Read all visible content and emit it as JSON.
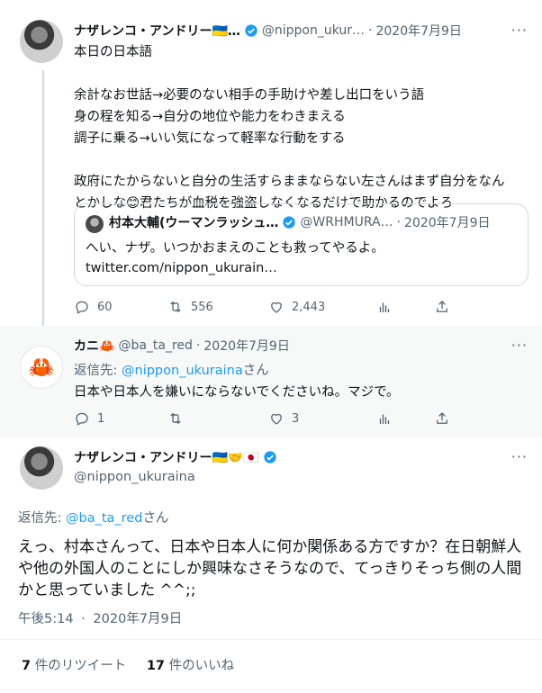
{
  "tweet1": {
    "name": "ナザレンコ・アンドリー🇺🇦…",
    "handle": "@nippon_ukur…",
    "separator": "·",
    "date": "2020年7月9日",
    "more": "···",
    "lines": [
      "本日の日本語",
      "",
      "余計なお世話→必要のない相手の手助けや差し出口をいう語",
      "身の程を知る→自分の地位や能力をわきまえる",
      "調子に乗る→いい気になって軽率な行動をする",
      "",
      "政府にたからないと自分の生活すらままならない左さんはまず自分をなん",
      "とかしな😊君たちが血税を強盗しなくなるだけで助かるのでよろ"
    ],
    "quote": {
      "name": "村本大輔(ウーマンラッシュ…",
      "handle": "@WRHMURA…",
      "separator": "·",
      "date": "2020年7月9日",
      "line1": "へい、ナザ。いつかおまえのことも救ってやるよ。",
      "line2": "twitter.com/nippon_ukurain…"
    },
    "actions": {
      "replies": "60",
      "retweets": "556",
      "likes": "2,443"
    }
  },
  "tweet2": {
    "name": "カニ🦀",
    "handle": "@ba_ta_red",
    "separator": "·",
    "date": "2020年7月9日",
    "more": "···",
    "reply_prefix": "返信先: ",
    "reply_handle": "@nippon_ukuraina",
    "reply_suffix": "さん",
    "text": "日本や日本人を嫌いにならないでくださいね。マジで。",
    "actions": {
      "replies": "1",
      "retweets": "",
      "likes": "3"
    }
  },
  "main_tweet": {
    "name": "ナザレンコ・アンドリー🇺🇦🤝🇯🇵",
    "handle": "@nippon_ukuraina",
    "more": "···",
    "reply_prefix": "返信先: ",
    "reply_handle": "@ba_ta_red",
    "reply_suffix": "さん",
    "lines": [
      "えっ、村本さんって、日本や日本人に何か関係ある方ですか？在日朝鮮人",
      "や他の外国人のことにしか興味なさそうなので、てっきりそっち側の人間",
      "かと思っていました ^^;;"
    ],
    "time": "午後5:14",
    "separator": "·",
    "date": "2020年7月9日",
    "retweet_count": "7",
    "retweet_label": "件のリツイート",
    "like_count": "17",
    "like_label": "件のいいね"
  },
  "colors": {
    "accent": "#1d9bf0",
    "muted": "#536471",
    "text": "#0f1419"
  },
  "icons": [
    "verified-icon",
    "reply-icon",
    "retweet-icon",
    "like-icon",
    "analytics-icon",
    "share-icon",
    "more-icon",
    "crab-icon"
  ]
}
